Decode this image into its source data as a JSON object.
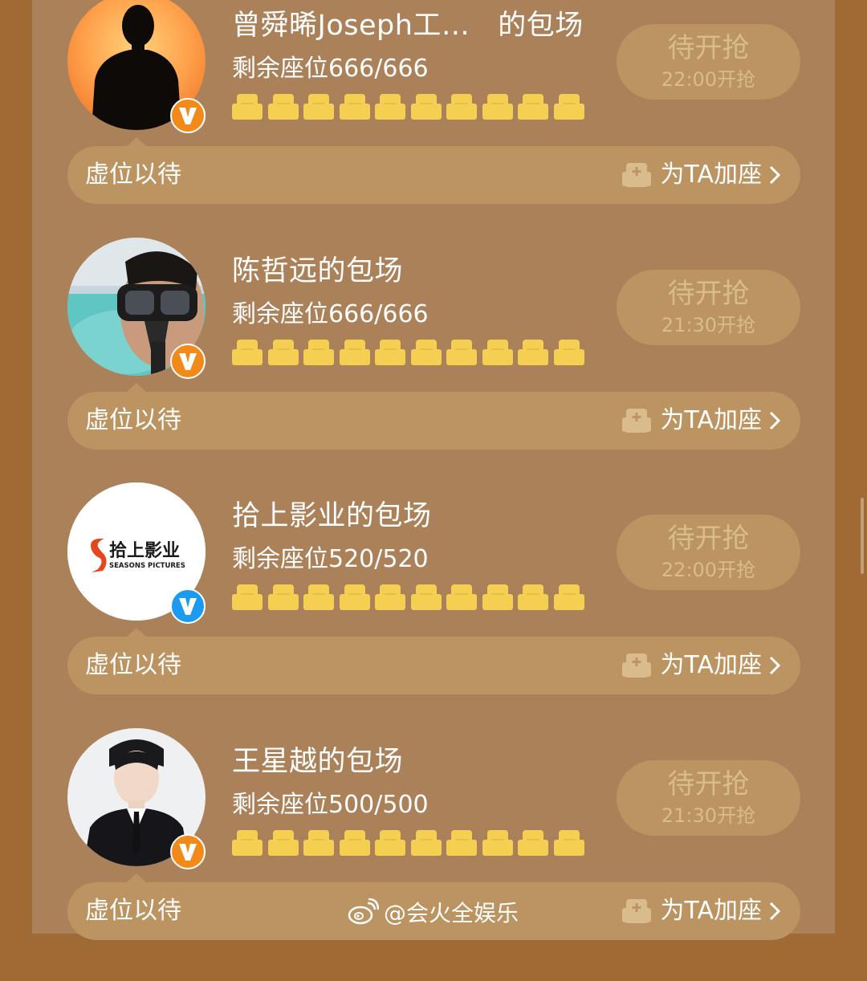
{
  "colors": {
    "background": "#a06a34",
    "panel": "#ab815a",
    "pill": "#bb9462",
    "seat": "#f5cf52",
    "disabled_text": "#d8bc8a",
    "verified_badge_orange": "#f28a1a",
    "verified_badge_blue": "#1a9af2"
  },
  "cards": [
    {
      "title": "曾舜晞Joseph工…   的包场",
      "seats_remaining": "剩余座位666/666",
      "seat_count": 10,
      "button_main": "待开抢",
      "button_sub": "22:00开抢",
      "bar_label": "虚位以待",
      "add_seat_label": "为TA加座",
      "avatar_icon": "silhouette-avatar",
      "badge_icon": "verified-orange-v-icon"
    },
    {
      "title": "陈哲远的包场",
      "seats_remaining": "剩余座位666/666",
      "seat_count": 10,
      "button_main": "待开抢",
      "button_sub": "21:30开抢",
      "bar_label": "虚位以待",
      "add_seat_label": "为TA加座",
      "avatar_icon": "snorkel-photo-avatar",
      "badge_icon": "verified-orange-v-icon"
    },
    {
      "title": "拾上影业的包场",
      "seats_remaining": "剩余座位520/520",
      "seat_count": 10,
      "button_main": "待开抢",
      "button_sub": "22:00开抢",
      "bar_label": "虚位以待",
      "add_seat_label": "为TA加座",
      "avatar_icon": "studio-logo-avatar",
      "avatar_logo_text": "拾上影业",
      "avatar_logo_subtext": "SEASONS PICTURES",
      "badge_icon": "verified-blue-v-icon"
    },
    {
      "title": "王星越的包场",
      "seats_remaining": "剩余座位500/500",
      "seat_count": 10,
      "button_main": "待开抢",
      "button_sub": "21:30开抢",
      "bar_label": "虚位以待",
      "add_seat_label": "为TA加座",
      "avatar_icon": "suit-portrait-avatar",
      "badge_icon": "verified-orange-v-icon"
    }
  ],
  "watermark": {
    "icon": "weibo-icon",
    "text": "@会火全娱乐"
  }
}
